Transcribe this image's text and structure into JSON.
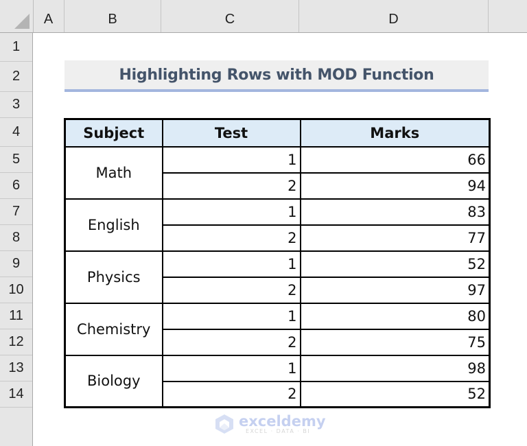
{
  "sheet": {
    "columns": [
      "A",
      "B",
      "C",
      "D"
    ],
    "rows": [
      "1",
      "2",
      "3",
      "4",
      "5",
      "6",
      "7",
      "8",
      "9",
      "10",
      "11",
      "12",
      "13",
      "14"
    ]
  },
  "title": "Highlighting Rows with MOD Function",
  "table": {
    "headers": [
      "Subject",
      "Test",
      "Marks"
    ],
    "groups": [
      {
        "subject": "Math",
        "tests": [
          {
            "test": "1",
            "marks": "66"
          },
          {
            "test": "2",
            "marks": "94"
          }
        ]
      },
      {
        "subject": "English",
        "tests": [
          {
            "test": "1",
            "marks": "83"
          },
          {
            "test": "2",
            "marks": "77"
          }
        ]
      },
      {
        "subject": "Physics",
        "tests": [
          {
            "test": "1",
            "marks": "52"
          },
          {
            "test": "2",
            "marks": "97"
          }
        ]
      },
      {
        "subject": "Chemistry",
        "tests": [
          {
            "test": "1",
            "marks": "80"
          },
          {
            "test": "2",
            "marks": "75"
          }
        ]
      },
      {
        "subject": "Biology",
        "tests": [
          {
            "test": "1",
            "marks": "98"
          },
          {
            "test": "2",
            "marks": "52"
          }
        ]
      }
    ]
  },
  "watermark": {
    "name": "exceldemy",
    "tagline": "EXCEL · DATA · BI"
  },
  "colors": {
    "header_fill": "#ddebf7",
    "title_text": "#44546a",
    "title_underline": "#a3b6de"
  }
}
